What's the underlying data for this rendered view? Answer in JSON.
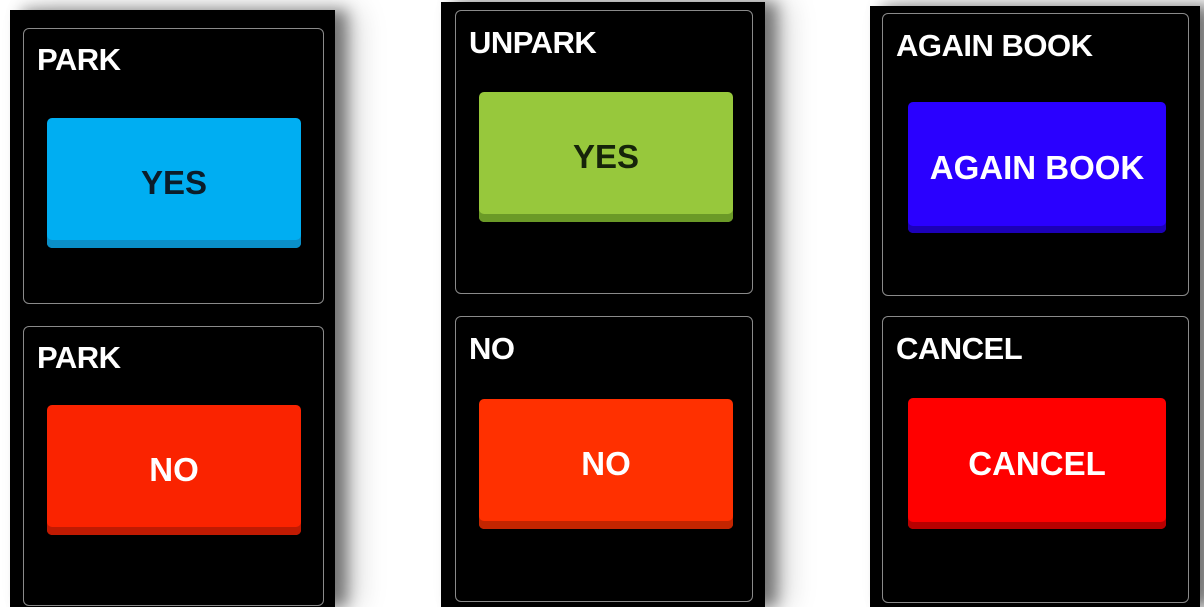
{
  "panels": [
    {
      "top_card": {
        "title": "PARK",
        "button_label": "YES",
        "button_color": "#00aef2"
      },
      "bottom_card": {
        "title": "PARK",
        "button_label": "NO",
        "button_color": "#fa2300"
      }
    },
    {
      "top_card": {
        "title": "UNPARK",
        "button_label": "YES",
        "button_color": "#97c83c"
      },
      "bottom_card": {
        "title": "NO",
        "button_label": "NO",
        "button_color": "#ff3000"
      }
    },
    {
      "top_card": {
        "title": "AGAIN BOOK",
        "button_label": "AGAIN BOOK",
        "button_color": "#2a00ff"
      },
      "bottom_card": {
        "title": "CANCEL",
        "button_label": "CANCEL",
        "button_color": "#ff0000"
      }
    }
  ]
}
